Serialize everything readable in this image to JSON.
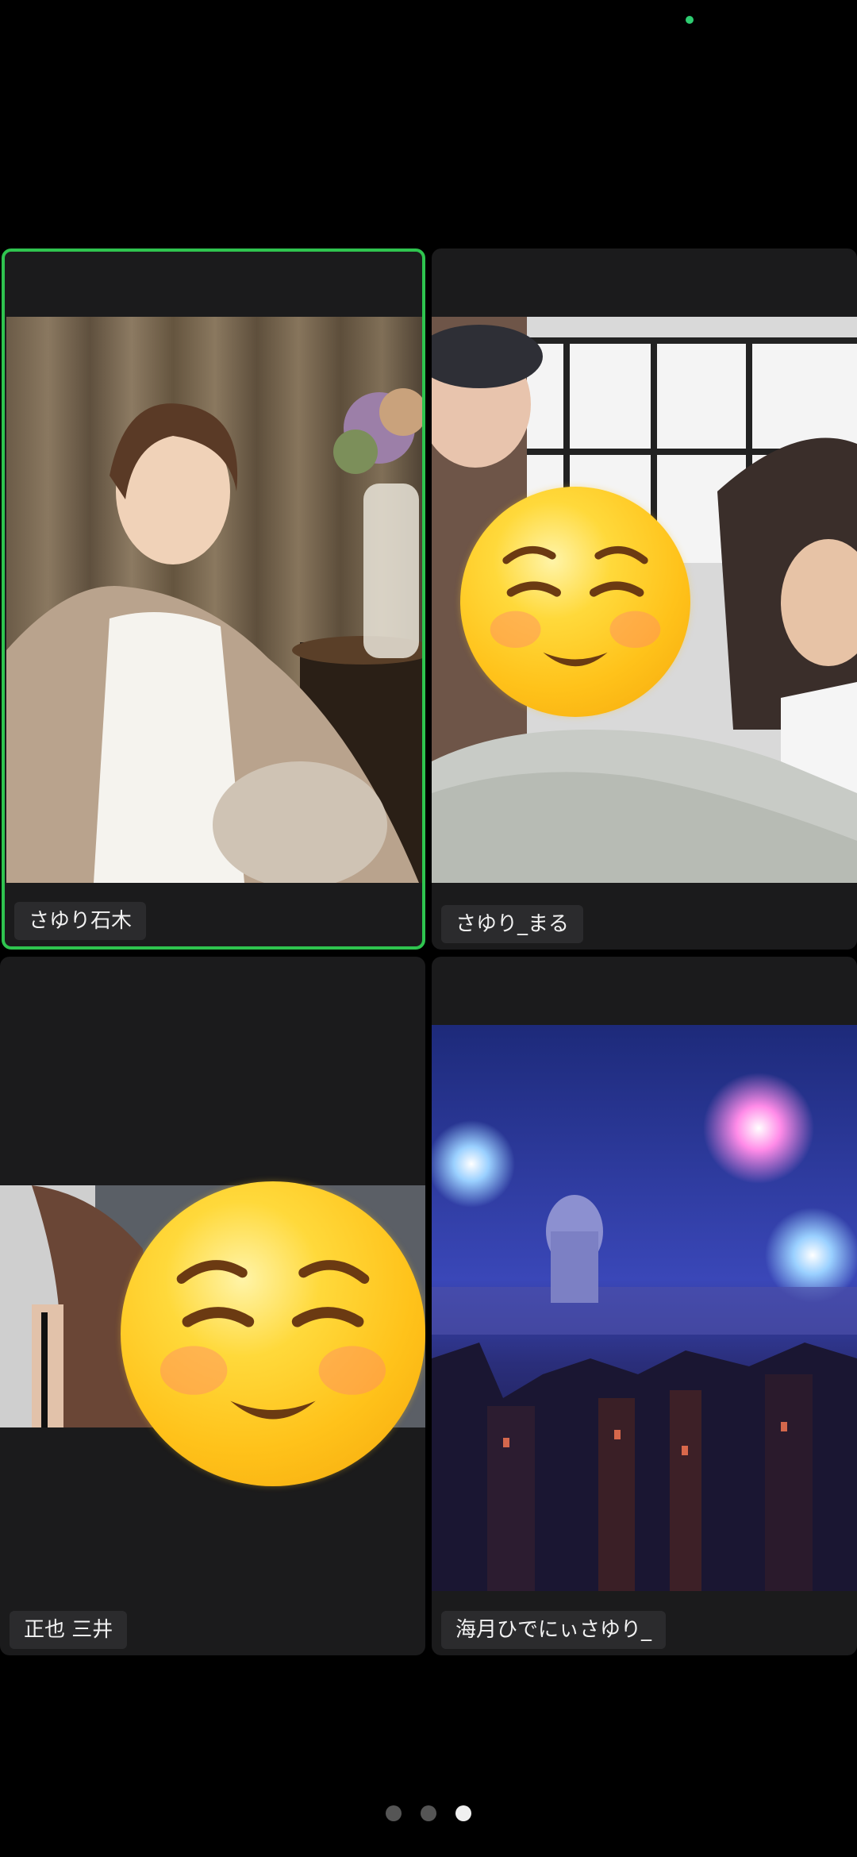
{
  "participants": [
    {
      "name": "さゆり石木",
      "active_speaker": true,
      "video_on": true,
      "emoji_overlay": false
    },
    {
      "name": "さゆり_まる",
      "active_speaker": false,
      "video_on": true,
      "emoji_overlay": true
    },
    {
      "name": "正也 三井",
      "active_speaker": false,
      "video_on": true,
      "emoji_overlay": true
    },
    {
      "name": "海月ひでにぃさゆり_",
      "active_speaker": false,
      "video_on": true,
      "emoji_overlay": false
    }
  ],
  "pager": {
    "total_pages": 3,
    "current_page": 3
  },
  "colors": {
    "background": "#000000",
    "tile": "#1b1b1c",
    "active_border": "#2fc44f",
    "label_bg": "#2b2b2d",
    "status_dot": "#2ecc71"
  },
  "icons": [
    "smiling-face-emoji-icon",
    "page-indicator-dot-icon"
  ]
}
